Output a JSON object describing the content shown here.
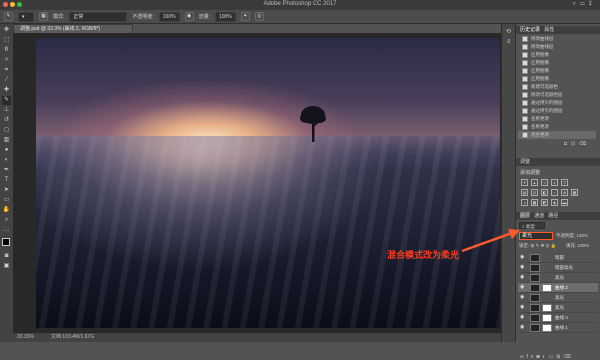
{
  "window": {
    "title": "Adobe Photoshop CC 2017"
  },
  "options_bar": {
    "mode_label": "模式:",
    "mode_value": "正常",
    "opacity_label": "不透明度:",
    "opacity_value": "100%",
    "flow_label": "流量:",
    "flow_value": "100%"
  },
  "document_tab": {
    "label": "调整.psd @ 33.3% (曲线 2, RGB/8*)"
  },
  "status_bar": {
    "zoom": "33.33%",
    "doc_info": "文档:103.4M/1.67G"
  },
  "history_panel": {
    "tabs": [
      "历史记录",
      "属性"
    ],
    "items": [
      "修改曲线层",
      "修改曲线层",
      "应用图像",
      "应用图像",
      "应用图像",
      "应用图像",
      "新建可选颜色",
      "修改可选颜色层",
      "通过拷贝的图层",
      "通过拷贝的图层",
      "名称更改",
      "名称更改",
      "混合更改"
    ]
  },
  "adjustments_panel": {
    "tab": "调整",
    "subtitle": "添加调整"
  },
  "layers_panel": {
    "tabs": [
      "图层",
      "通道",
      "路径"
    ],
    "kind_label": "类型",
    "blend_mode": "柔光",
    "opacity_label": "不透明度:",
    "opacity_value": "100%",
    "lock_label": "锁定:",
    "fill_label": "填充:",
    "fill_value": "100%",
    "layers": [
      {
        "name": "暗部"
      },
      {
        "name": "暗部高光"
      },
      {
        "name": "高光"
      },
      {
        "name": "曲线 2"
      },
      {
        "name": "高光"
      },
      {
        "name": "柔光"
      },
      {
        "name": "曲线 3"
      },
      {
        "name": "曲线 1"
      }
    ]
  },
  "annotation": {
    "text": "混合模式改为柔光",
    "color": "#ff3b1f"
  },
  "colors": {
    "panel_bg": "#535353",
    "dark_bg": "#282828",
    "titlebar": "#3a3a3a",
    "accent": "#ff3b1f"
  }
}
